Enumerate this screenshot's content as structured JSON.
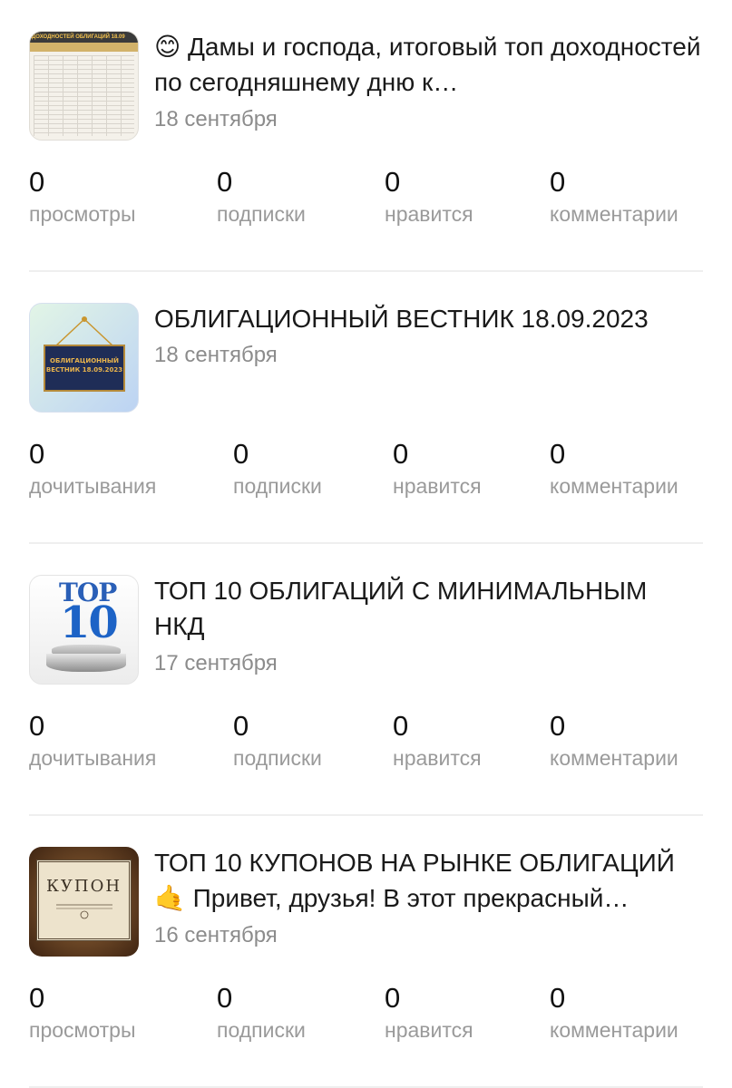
{
  "posts": [
    {
      "title": "😊 Дамы и господа, итоговый топ доходностей по сегодняшнему дню к…",
      "date": "18 сентября",
      "thumb_icon": "bond-yield-table-thumbnail",
      "thumb_text": "ДОХОДНОСТЕЙ ОБЛИГАЦИЙ 18.09",
      "stats": [
        {
          "value": "0",
          "label": "просмотры"
        },
        {
          "value": "0",
          "label": "подписки"
        },
        {
          "value": "0",
          "label": "нравится"
        },
        {
          "value": "0",
          "label": "комментарии"
        }
      ]
    },
    {
      "title": "ОБЛИГАЦИОННЫЙ ВЕСТНИК 18.09.2023",
      "date": "18 сентября",
      "thumb_icon": "hanging-sign-thumbnail",
      "thumb_text": "ОБЛИГАЦИОННЫЙ ВЕСТНИК 18.09.2023",
      "stats": [
        {
          "value": "0",
          "label": "дочитывания"
        },
        {
          "value": "0",
          "label": "подписки"
        },
        {
          "value": "0",
          "label": "нравится"
        },
        {
          "value": "0",
          "label": "комментарии"
        }
      ]
    },
    {
      "title": "ТОП 10 ОБЛИГАЦИЙ С МИНИМАЛЬНЫМ НКД",
      "date": "17 сентября",
      "thumb_icon": "top-10-pedestal-thumbnail",
      "thumb_text_1": "TOP",
      "thumb_text_2": "10",
      "stats": [
        {
          "value": "0",
          "label": "дочитывания"
        },
        {
          "value": "0",
          "label": "подписки"
        },
        {
          "value": "0",
          "label": "нравится"
        },
        {
          "value": "0",
          "label": "комментарии"
        }
      ]
    },
    {
      "title": "ТОП 10 КУПОНОВ НА РЫНКЕ ОБЛИГАЦИЙ 🤙 Привет, друзья! В этот прекрасный…",
      "date": "16 сентября",
      "thumb_icon": "vintage-coupon-thumbnail",
      "thumb_text": "КУПОН",
      "stats": [
        {
          "value": "0",
          "label": "просмотры"
        },
        {
          "value": "0",
          "label": "подписки"
        },
        {
          "value": "0",
          "label": "нравится"
        },
        {
          "value": "0",
          "label": "комментарии"
        }
      ]
    }
  ]
}
